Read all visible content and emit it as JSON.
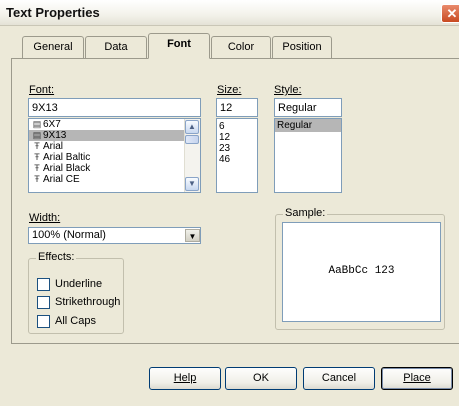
{
  "window": {
    "title": "Text Properties",
    "close_glyph": "✕"
  },
  "tabs": [
    {
      "label": "General",
      "active": false
    },
    {
      "label": "Data",
      "active": false
    },
    {
      "label": "Font",
      "active": true
    },
    {
      "label": "Color",
      "active": false
    },
    {
      "label": "Position",
      "active": false
    }
  ],
  "font": {
    "label": "Font:",
    "value": "9X13",
    "items": [
      {
        "name": "6X7",
        "icon": "bitmap-font-icon"
      },
      {
        "name": "9X13",
        "icon": "bitmap-font-icon",
        "selected": true
      },
      {
        "name": "Arial",
        "icon": "truetype-font-icon"
      },
      {
        "name": "Arial Baltic",
        "icon": "truetype-font-icon"
      },
      {
        "name": "Arial Black",
        "icon": "truetype-font-icon"
      },
      {
        "name": "Arial CE",
        "icon": "truetype-font-icon"
      }
    ]
  },
  "size": {
    "label": "Size:",
    "value": "12",
    "items": [
      "6",
      "12",
      "23",
      "46"
    ]
  },
  "style": {
    "label": "Style:",
    "value": "Regular",
    "items": [
      "Regular"
    ]
  },
  "width": {
    "label": "Width:",
    "value": "100% (Normal)"
  },
  "effects": {
    "label": "Effects:",
    "items": [
      {
        "label": "Underline",
        "checked": false
      },
      {
        "label": "Strikethrough",
        "checked": false
      },
      {
        "label": "All Caps",
        "checked": false
      }
    ]
  },
  "sample": {
    "label": "Sample:",
    "text": "AaBbCc 123"
  },
  "buttons": {
    "help": "Help",
    "ok": "OK",
    "cancel": "Cancel",
    "place": "Place"
  },
  "colors": {
    "selection": "#b6b6b6",
    "field_border": "#7f9db9",
    "face": "#ece9d8"
  }
}
